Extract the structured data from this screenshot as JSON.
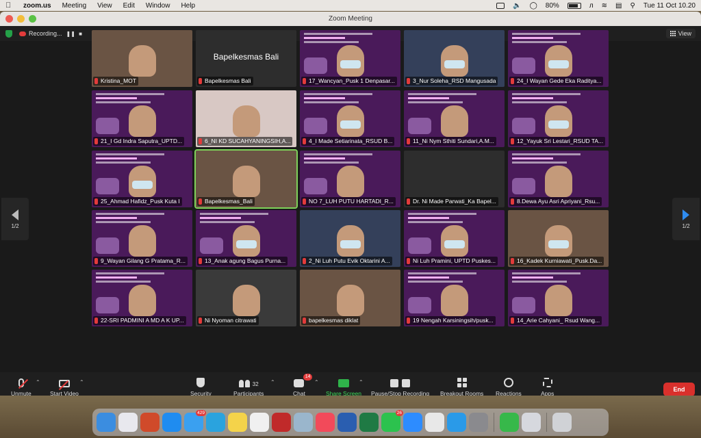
{
  "menubar": {
    "app": "zoom.us",
    "items": [
      "Meeting",
      "View",
      "Edit",
      "Window",
      "Help"
    ],
    "battery": "80%",
    "datetime": "Tue 11 Oct 10.20"
  },
  "window": {
    "title": "Zoom Meeting"
  },
  "status": {
    "recording": "Recording...",
    "view": "View"
  },
  "participants": [
    {
      "name": "Kristina_MOT",
      "type": "video-room"
    },
    {
      "name": "Bapelkesmas Bali",
      "type": "name-only",
      "big": "Bapelkesmas Bali"
    },
    {
      "name": "17_Wancyan_Pusk 1 Denpasar...",
      "type": "purple-face-mask"
    },
    {
      "name": "3_Nur Soleha_RSD Mangusada",
      "type": "dark-face-mask"
    },
    {
      "name": "24_I Wayan Gede Eka Raditya...",
      "type": "purple-face-mask"
    },
    {
      "name": "21_I Gd Indra Saputra_UPTD...",
      "type": "purple-face"
    },
    {
      "name": "6_NI KD SUCAHYANINGSIH,A...",
      "type": "light-face"
    },
    {
      "name": "4_I Made Setiarinata_RSUD B...",
      "type": "purple-face-mask"
    },
    {
      "name": "11_Ni Nym Sthiti Sundari,A.M...",
      "type": "purple-face"
    },
    {
      "name": "12_Yayuk Sri Lestari_RSUD TA...",
      "type": "purple-face-mask"
    },
    {
      "name": "25_Ahmad Hafidz_Pusk Kuta I",
      "type": "purple-face-mask"
    },
    {
      "name": "Bapelkesmas_Bali",
      "type": "room-face",
      "active": true
    },
    {
      "name": "NO 7_LUH PUTU HARTADI_R...",
      "type": "purple-face"
    },
    {
      "name": "Dr. Ni Made Parwati_Ka Bapel...",
      "type": "blank"
    },
    {
      "name": "8.Dewa Ayu Asri Apriyani_Rsu...",
      "type": "purple-face"
    },
    {
      "name": "9_Wayan Gilang G Pratama_R...",
      "type": "purple-face"
    },
    {
      "name": "13_Anak agung Bagus Purna...",
      "type": "purple-face-mask"
    },
    {
      "name": "2_Ni Luh Putu Evik Oktarini A...",
      "type": "dark-face-mask"
    },
    {
      "name": "Ni Luh Pramini, UPTD Puskes...",
      "type": "purple-face-mask"
    },
    {
      "name": "16_Kadek Kurniawati_Pusk.Da...",
      "type": "room-face-mask"
    },
    {
      "name": "22-SRI PADMINI A MD A K UP...",
      "type": "purple-face"
    },
    {
      "name": "Ni Nyoman citrawati",
      "type": "dark-closeup"
    },
    {
      "name": "bapelkesmas diklat",
      "type": "room-face"
    },
    {
      "name": "19 Nengah Karsiningsih/pusk...",
      "type": "purple-face"
    },
    {
      "name": "14_Arie Cahyani_ Rsud Wang...",
      "type": "purple-face"
    }
  ],
  "pager": {
    "left": "1/2",
    "right": "1/2"
  },
  "toolbar": {
    "unmute": "Unmute",
    "start_video": "Start Video",
    "security": "Security",
    "participants": "Participants",
    "participants_count": "32",
    "chat": "Chat",
    "chat_badge": "14",
    "share": "Share Screen",
    "record": "Pause/Stop Recording",
    "rooms": "Breakout Rooms",
    "reactions": "Reactions",
    "apps": "Apps",
    "end": "End"
  },
  "dock": {
    "apps": [
      {
        "icon": "finder-icon",
        "color": "#3b8de0"
      },
      {
        "icon": "launchpad-icon",
        "color": "#e8e8ee"
      },
      {
        "icon": "powerpoint-icon",
        "color": "#d04a2a"
      },
      {
        "icon": "app-store-icon",
        "color": "#1f8cf0"
      },
      {
        "icon": "mail-icon",
        "color": "#3aa0f0",
        "badge": "429"
      },
      {
        "icon": "telegram-icon",
        "color": "#2aa3de"
      },
      {
        "icon": "notes-icon",
        "color": "#f4d34a"
      },
      {
        "icon": "photos-icon",
        "color": "#f0f0f0"
      },
      {
        "icon": "mendeley-icon",
        "color": "#c02a2a"
      },
      {
        "icon": "quicktime-icon",
        "color": "#9ab6cc"
      },
      {
        "icon": "music-icon",
        "color": "#f24a5a"
      },
      {
        "icon": "word-icon",
        "color": "#2a5eb0"
      },
      {
        "icon": "excel-icon",
        "color": "#1f7a44"
      },
      {
        "icon": "whatsapp-icon",
        "color": "#2cc24e",
        "badge": "26"
      },
      {
        "icon": "zoom-icon",
        "color": "#2d8cff"
      },
      {
        "icon": "chrome-icon",
        "color": "#e8e8e8"
      },
      {
        "icon": "safari-icon",
        "color": "#2a9ae8"
      },
      {
        "icon": "system-settings-icon",
        "color": "#8a8a8e"
      },
      {
        "icon": "facetime-icon",
        "color": "#37b84a"
      },
      {
        "icon": "preview-icon",
        "color": "#d6d8de"
      },
      {
        "icon": "trash-icon",
        "color": "#d0d2d6"
      }
    ]
  }
}
